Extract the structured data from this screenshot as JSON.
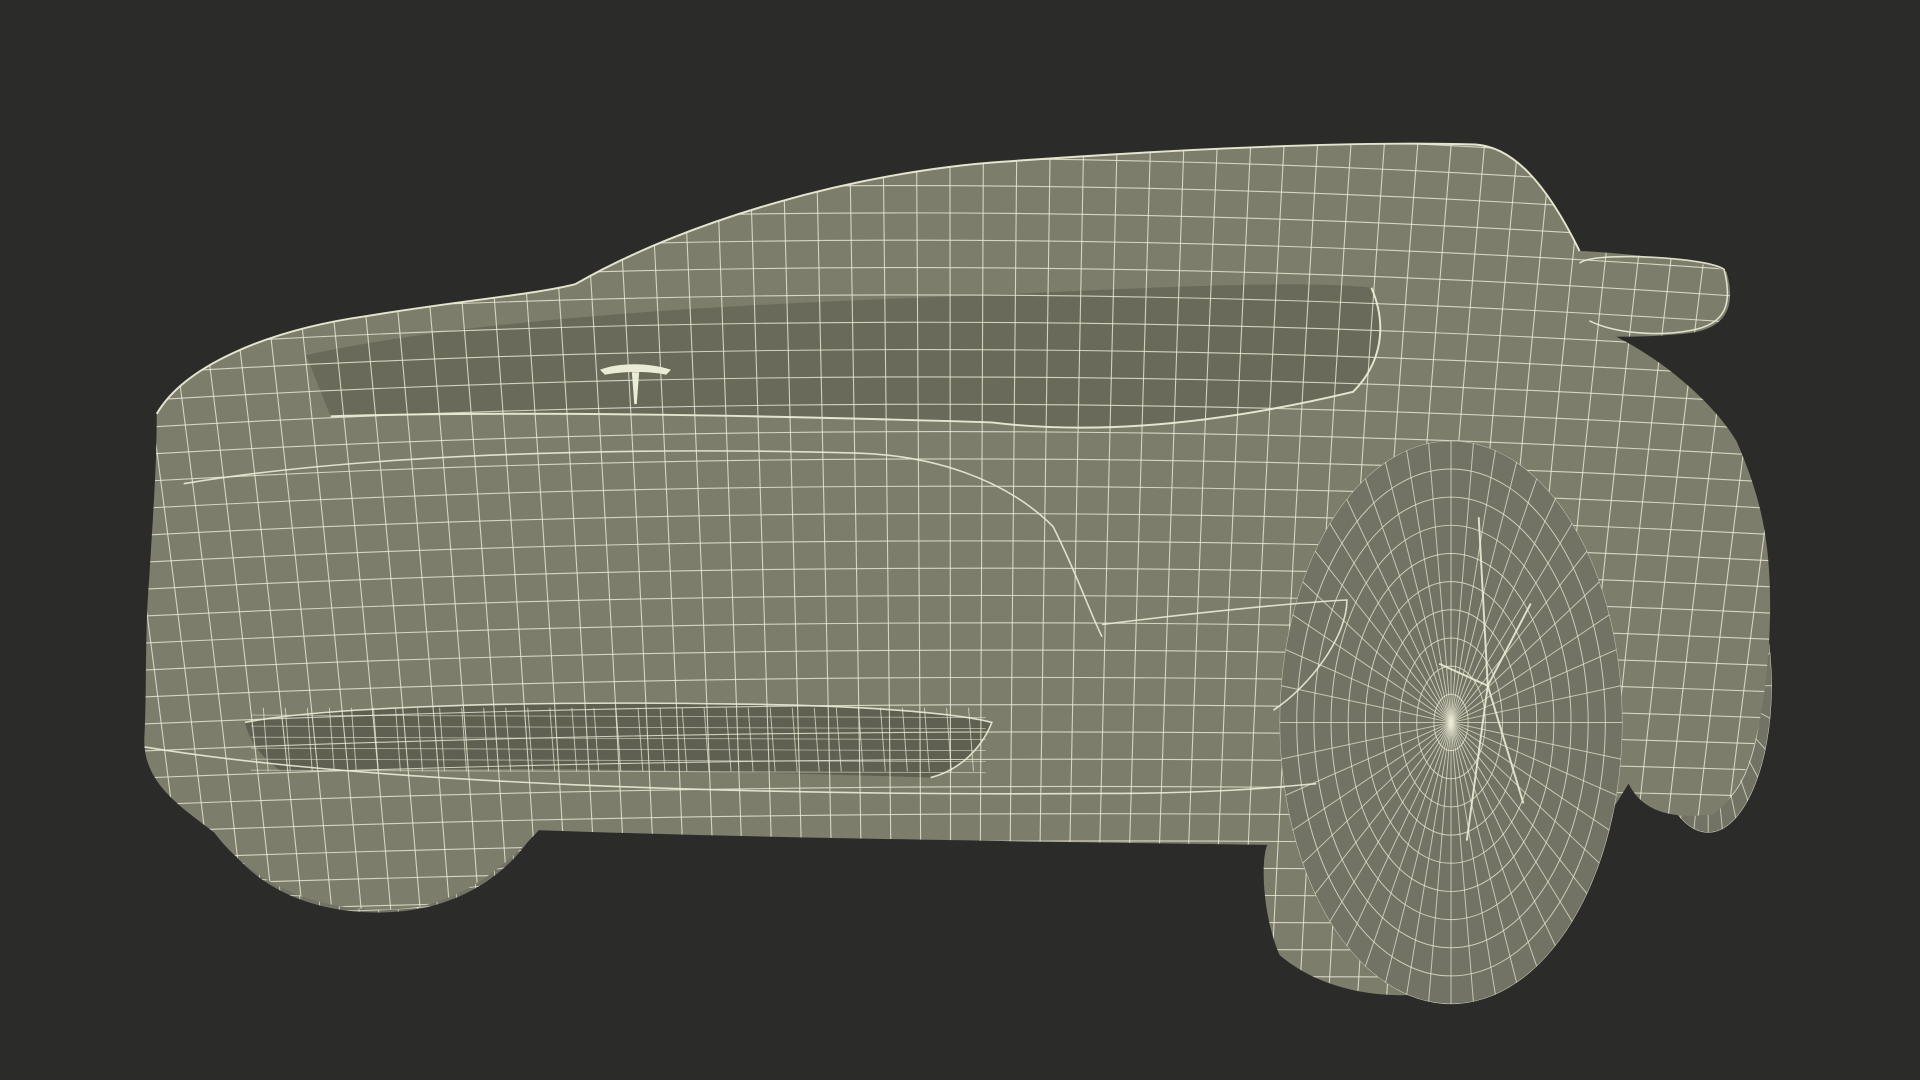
{
  "scene": {
    "background_color": "#2b2b29",
    "body_color": "#7d7d6c",
    "body_shadow_color": "#6a6a5b",
    "dark_panel_color": "#5f5f52",
    "tire_color": "#737365",
    "wire_color": "#ecebd6",
    "icons": [
      "car-wireframe-model",
      "logo-emblem-shape"
    ]
  }
}
